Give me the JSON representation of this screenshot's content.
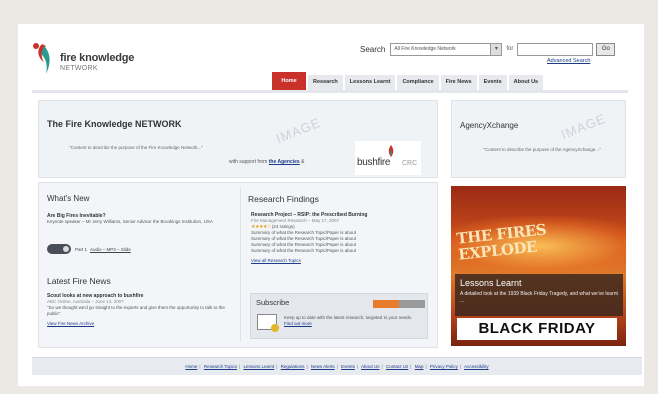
{
  "header": {
    "logo_title": "fire knowledge",
    "logo_sub": "NETWORK",
    "search_label": "Search",
    "search_scope": "All Fire Knowledge Network",
    "search_for": "for",
    "search_go": "Go",
    "advanced_search": "Advanced Search"
  },
  "nav": {
    "items": [
      "Home",
      "Research",
      "Lessons Learnt",
      "Compliance",
      "Fire News",
      "Events",
      "About Us"
    ],
    "active": "Home"
  },
  "hero": {
    "title": "The Fire Knowledge NETWORK",
    "description": "\"Content to describe the purpose of the Fire Knowledge Network...\"",
    "support_prefix": "with support from",
    "support_link": "the Agencies",
    "support_suffix": "&",
    "partner_logo_word": "bushfire",
    "partner_logo_suffix": "CRC",
    "watermark": "IMAGE"
  },
  "agency": {
    "title": "AgencyXchange",
    "description": "\"Content to describe the purpose of the AgencyXchange...\"",
    "watermark": "IMAGE"
  },
  "whats_new": {
    "title": "What's New",
    "headline": "Are Big Fires Inevitable?",
    "body": "Keynote speaker – Mr Jerry Williams, Senior Advisor the Brookings Institution, USA",
    "audio_part": "Part 1",
    "audio_links": "Audio – MP3 – Slide"
  },
  "latest_news": {
    "title": "Latest Fire News",
    "headline": "Scout looks at new approach to bushfire",
    "meta": "ABC Online, Australia – June 13, 2007",
    "body": "\"So we thought we'd go straight to the experts and give them the opportunity to talk to the public\"",
    "link": "View Fire News Archive"
  },
  "research": {
    "title": "Research Findings",
    "headline": "Research Project – RSIP: the Prescribed Burning",
    "meta": "Fire Management Research – May 17, 2007",
    "rating_text": "(24 ratings)",
    "summaries": [
      "Summary of what the Research Topic/Paper is about",
      "Summary of what the Research Topic/Paper is about",
      "Summary of what the Research Topic/Paper is about",
      "Summary of what the Research Topic/Paper is about"
    ],
    "link": "View all Research Topics"
  },
  "subscribe": {
    "title": "Subscribe",
    "body": "Keep up to date with the latest research, targeted to your needs.",
    "link": "Find out more",
    "bar_fill": 0.5
  },
  "lessons": {
    "headline": "THE FIRES EXPLODE",
    "title": "Lessons Learnt",
    "description": "A detailed look at the 1939 Black Friday Tragedy, and what we've learnt ...",
    "banner": "BLACK FRIDAY"
  },
  "footer": {
    "links": [
      "Home",
      "Research Topics",
      "Lessons Learnt",
      "Regulations",
      "News Alerts",
      "Events",
      "About Us",
      "Contact Us",
      "Map",
      "Privacy Policy",
      "Accessibility"
    ]
  },
  "colors": {
    "accent": "#c8322a",
    "link": "#1a3a8a",
    "panel": "#f0f3f6",
    "star": "#e59d1c",
    "subscribe_bar": "#e77d2b"
  }
}
